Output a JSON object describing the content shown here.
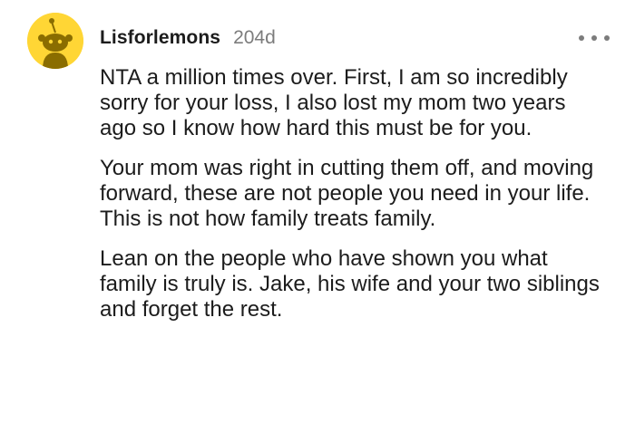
{
  "comment": {
    "username": "Lisforlemons",
    "age": "204d",
    "avatar_icon": "reddit-snoo-avatar-icon",
    "avatar_color": "#ffd635",
    "more_icon": "more-options-icon",
    "paragraphs": [
      "NTA a million times over. First, I am so incredibly sorry for your loss, I also lost my mom two years ago so I know how hard this must be for you.",
      "Your mom was right in cutting them off, and moving forward, these are not people you need in your life. This is not how family treats family.",
      "Lean on the people who have shown you what family is truly is. Jake, his wife and your two siblings and forget the rest."
    ]
  }
}
